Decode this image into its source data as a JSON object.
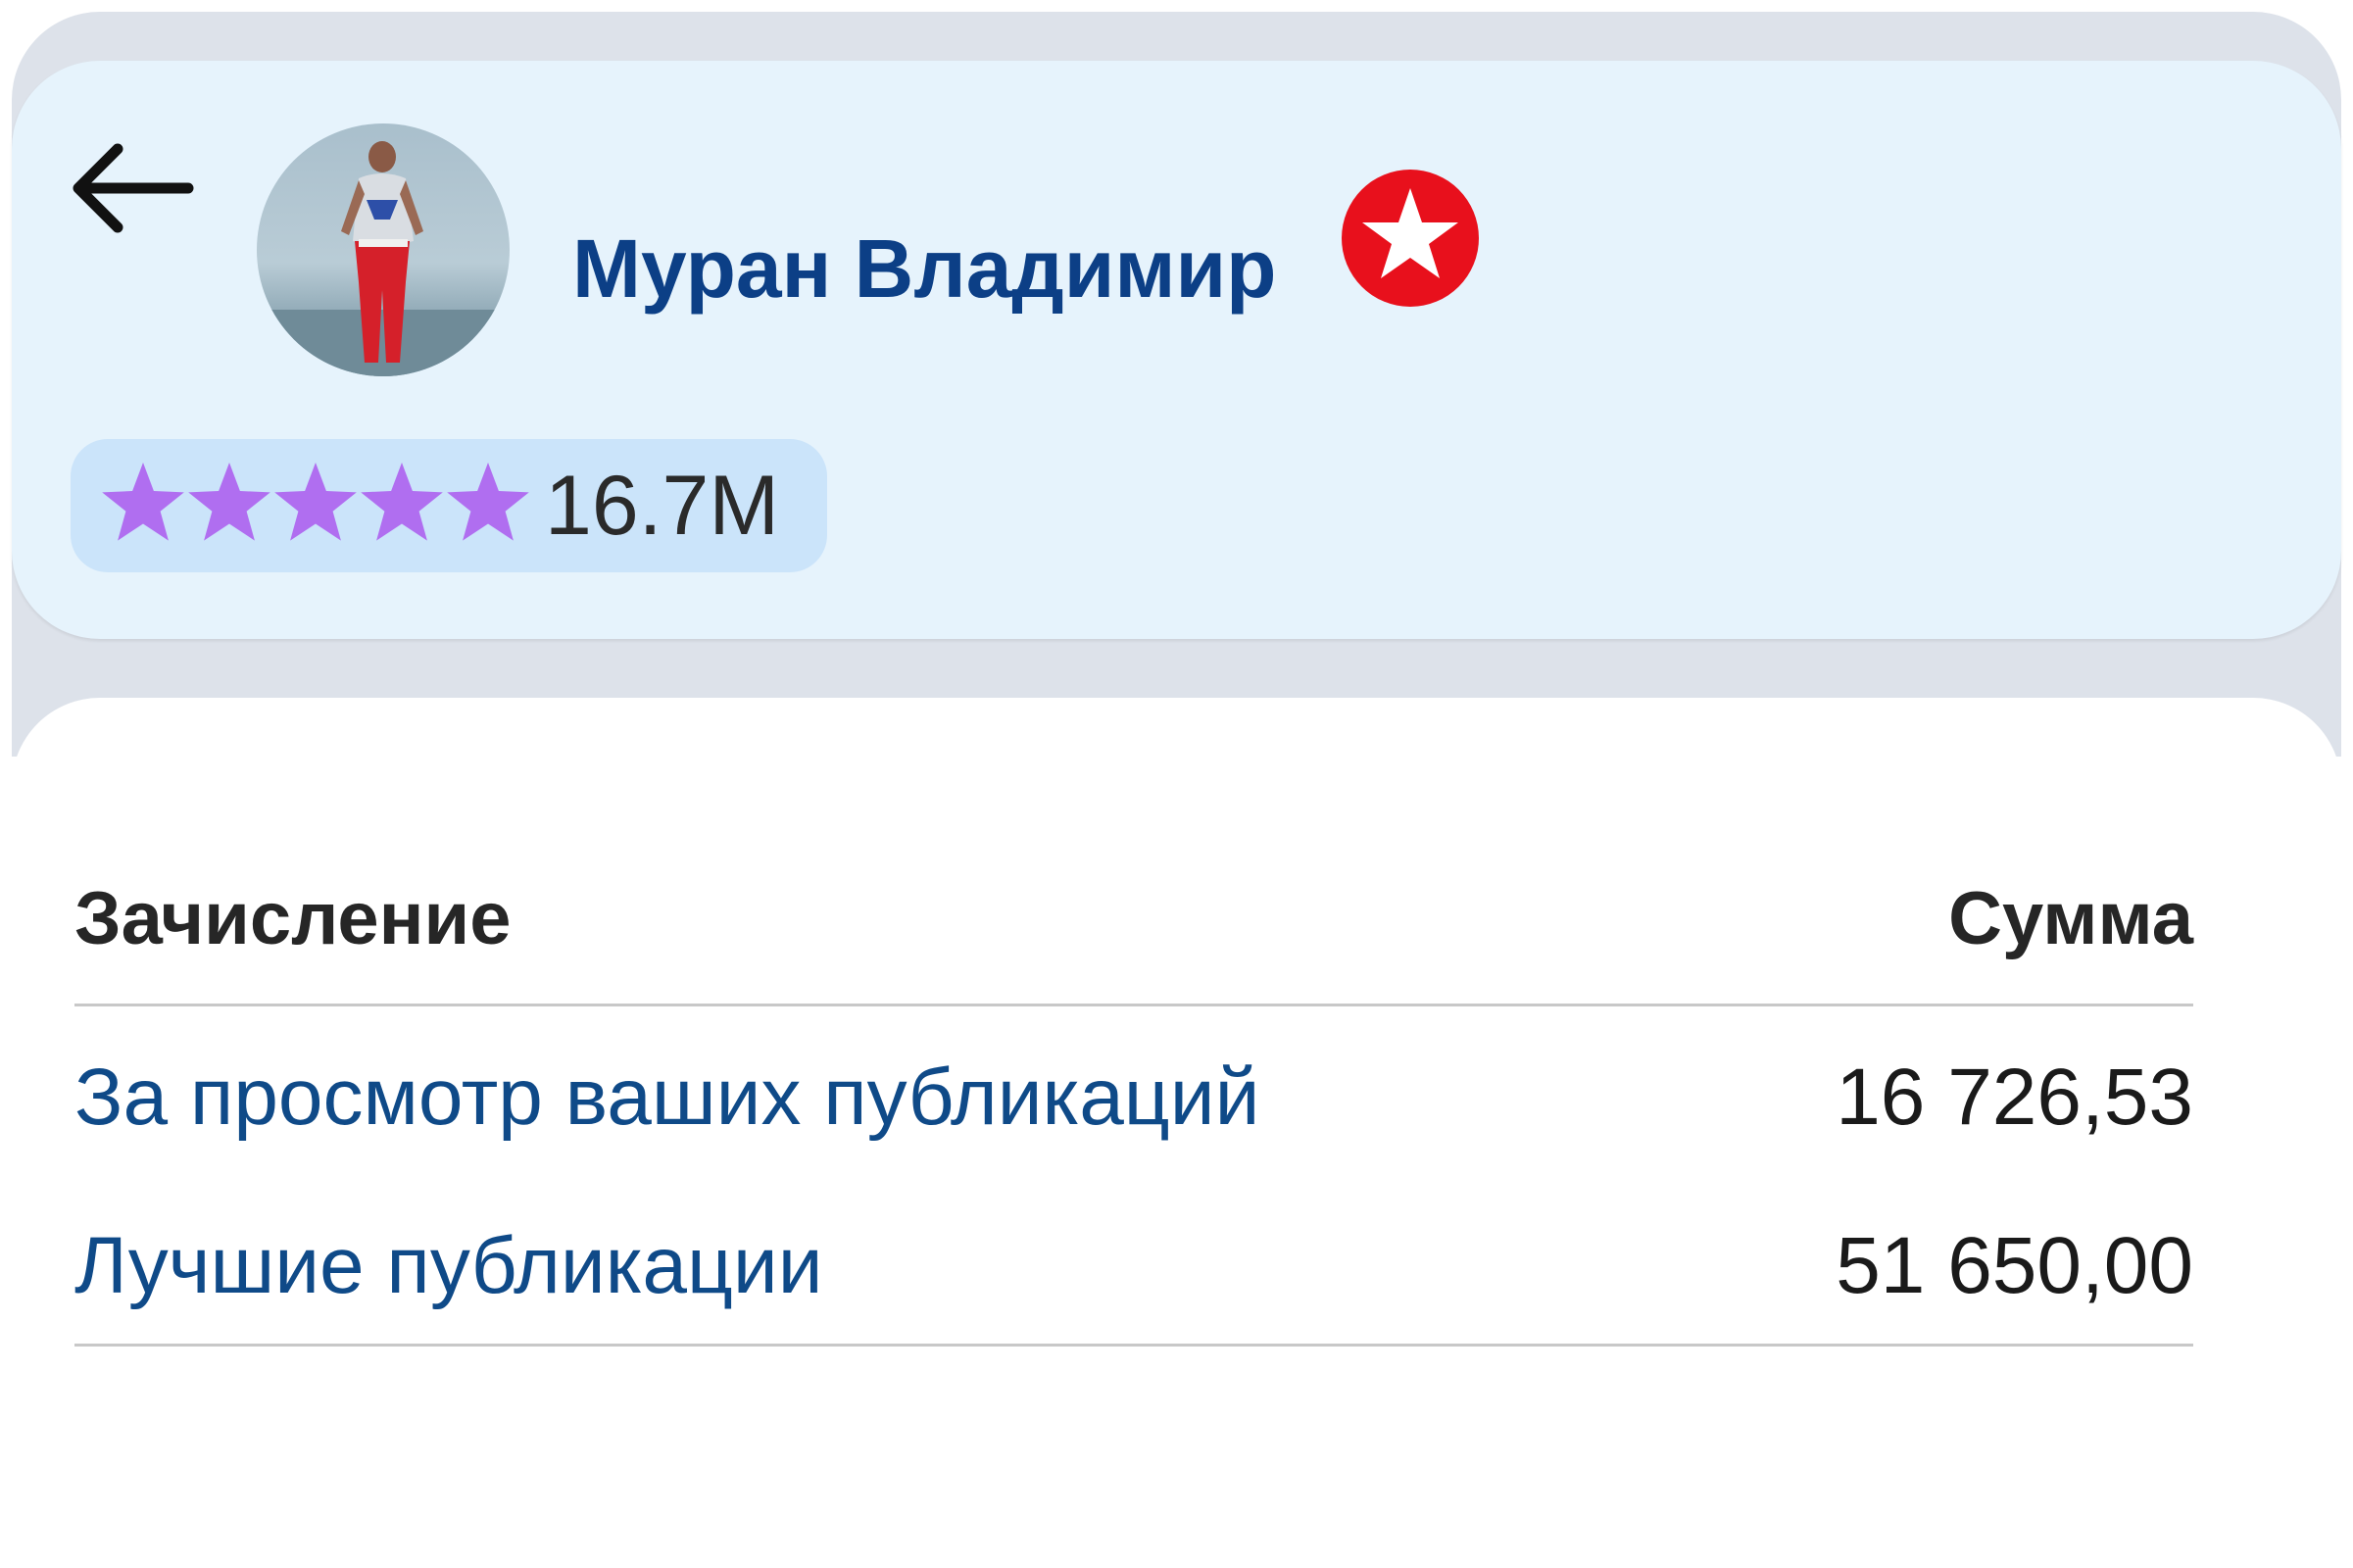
{
  "profile": {
    "name": "Муран Владимир",
    "rating_count": "16.7M",
    "rating_stars": 5,
    "badge_icon": "star-badge-icon",
    "badge_color": "#e8101c",
    "star_color": "#b06ef0",
    "name_color": "#0c3f86"
  },
  "navigation": {
    "back_icon": "arrow-left-icon"
  },
  "accruals_table": {
    "header": {
      "left": "Зачисление",
      "right": "Сумма"
    },
    "rows": [
      {
        "label": "За просмотр ваших публикаций",
        "amount": "16 726,53"
      },
      {
        "label": "Лучшие публикации",
        "amount": "51 650,00"
      }
    ]
  }
}
